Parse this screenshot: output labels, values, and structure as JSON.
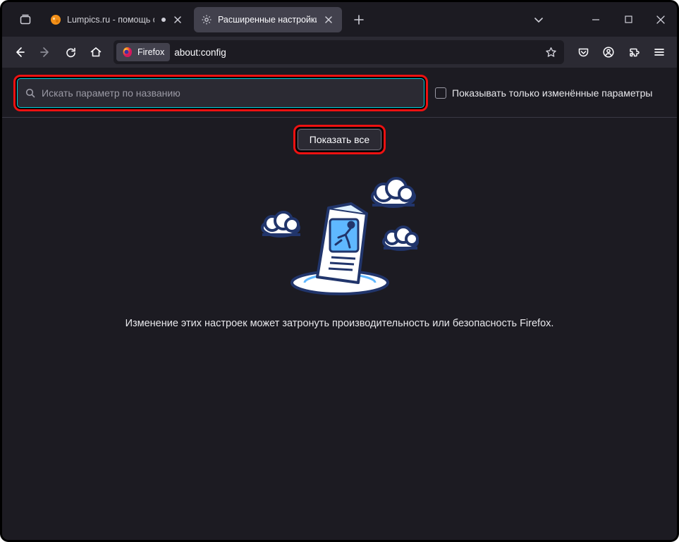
{
  "tabs": [
    {
      "label": "Lumpics.ru - помощь с компью"
    },
    {
      "label": "Расширенные настройки"
    }
  ],
  "toolbar": {
    "identity_label": "Firefox",
    "url": "about:config"
  },
  "config": {
    "search_placeholder": "Искать параметр по названию",
    "modified_only_label": "Показывать только изменённые параметры",
    "show_all_label": "Показать все",
    "caption": "Изменение этих настроек может затронуть производительность или безопасность Firefox."
  }
}
